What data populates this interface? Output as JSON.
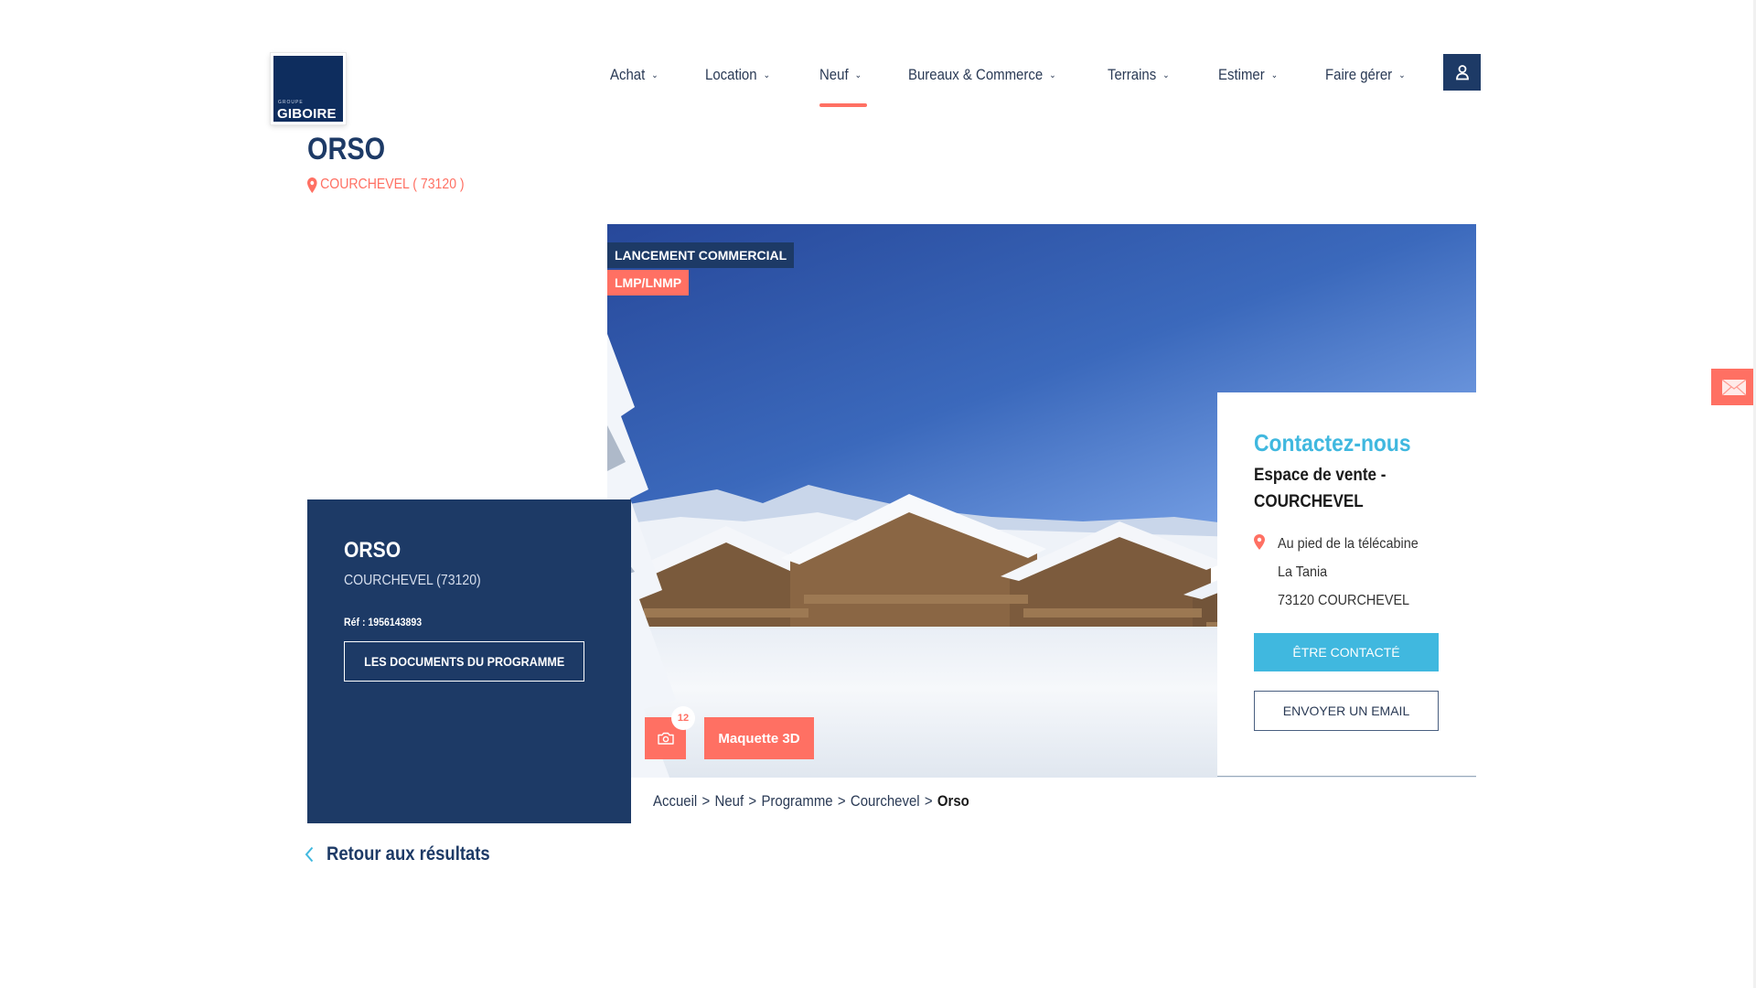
{
  "brand": {
    "logo_small": "GROUPE",
    "logo_big": "GIBOIRE"
  },
  "nav": {
    "items": [
      {
        "label": "Achat",
        "active": false
      },
      {
        "label": "Location",
        "active": false
      },
      {
        "label": "Neuf",
        "active": true
      },
      {
        "label": "Bureaux & Commerce",
        "active": false
      },
      {
        "label": "Terrains",
        "active": false
      },
      {
        "label": "Estimer",
        "active": false
      },
      {
        "label": "Faire gérer",
        "active": false
      }
    ],
    "chevron": "⌄",
    "user_icon": "user-icon"
  },
  "program": {
    "title": "ORSO",
    "location": "COURCHEVEL ( 73120 )"
  },
  "hero": {
    "tags": [
      "LANCEMENT COMMERCIAL",
      "LMP/LNMP"
    ],
    "photo_count": "12",
    "maquette_label": "Maquette 3D"
  },
  "info_card": {
    "title": "ORSO",
    "location": "COURCHEVEL (73120)",
    "ref": "Réf : 1956143893",
    "docs_button": "LES DOCUMENTS DU PROGRAMME"
  },
  "contact": {
    "title": "Contactez-nous",
    "subtitle": "Espace de vente - COURCHEVEL",
    "address": [
      "Au pied de la télécabine",
      "La Tania",
      "73120 COURCHEVEL"
    ],
    "btn_contact": "ÊTRE CONTACTÉ",
    "btn_email": "ENVOYER UN EMAIL"
  },
  "breadcrumb": {
    "items": [
      "Accueil",
      "Neuf",
      "Programme",
      "Courchevel"
    ],
    "current": "Orso",
    "separator": ">"
  },
  "back_link": "Retour aux résultats",
  "colors": {
    "navy": "#1d3a66",
    "coral": "#ff7063",
    "cyan": "#40b8df"
  }
}
